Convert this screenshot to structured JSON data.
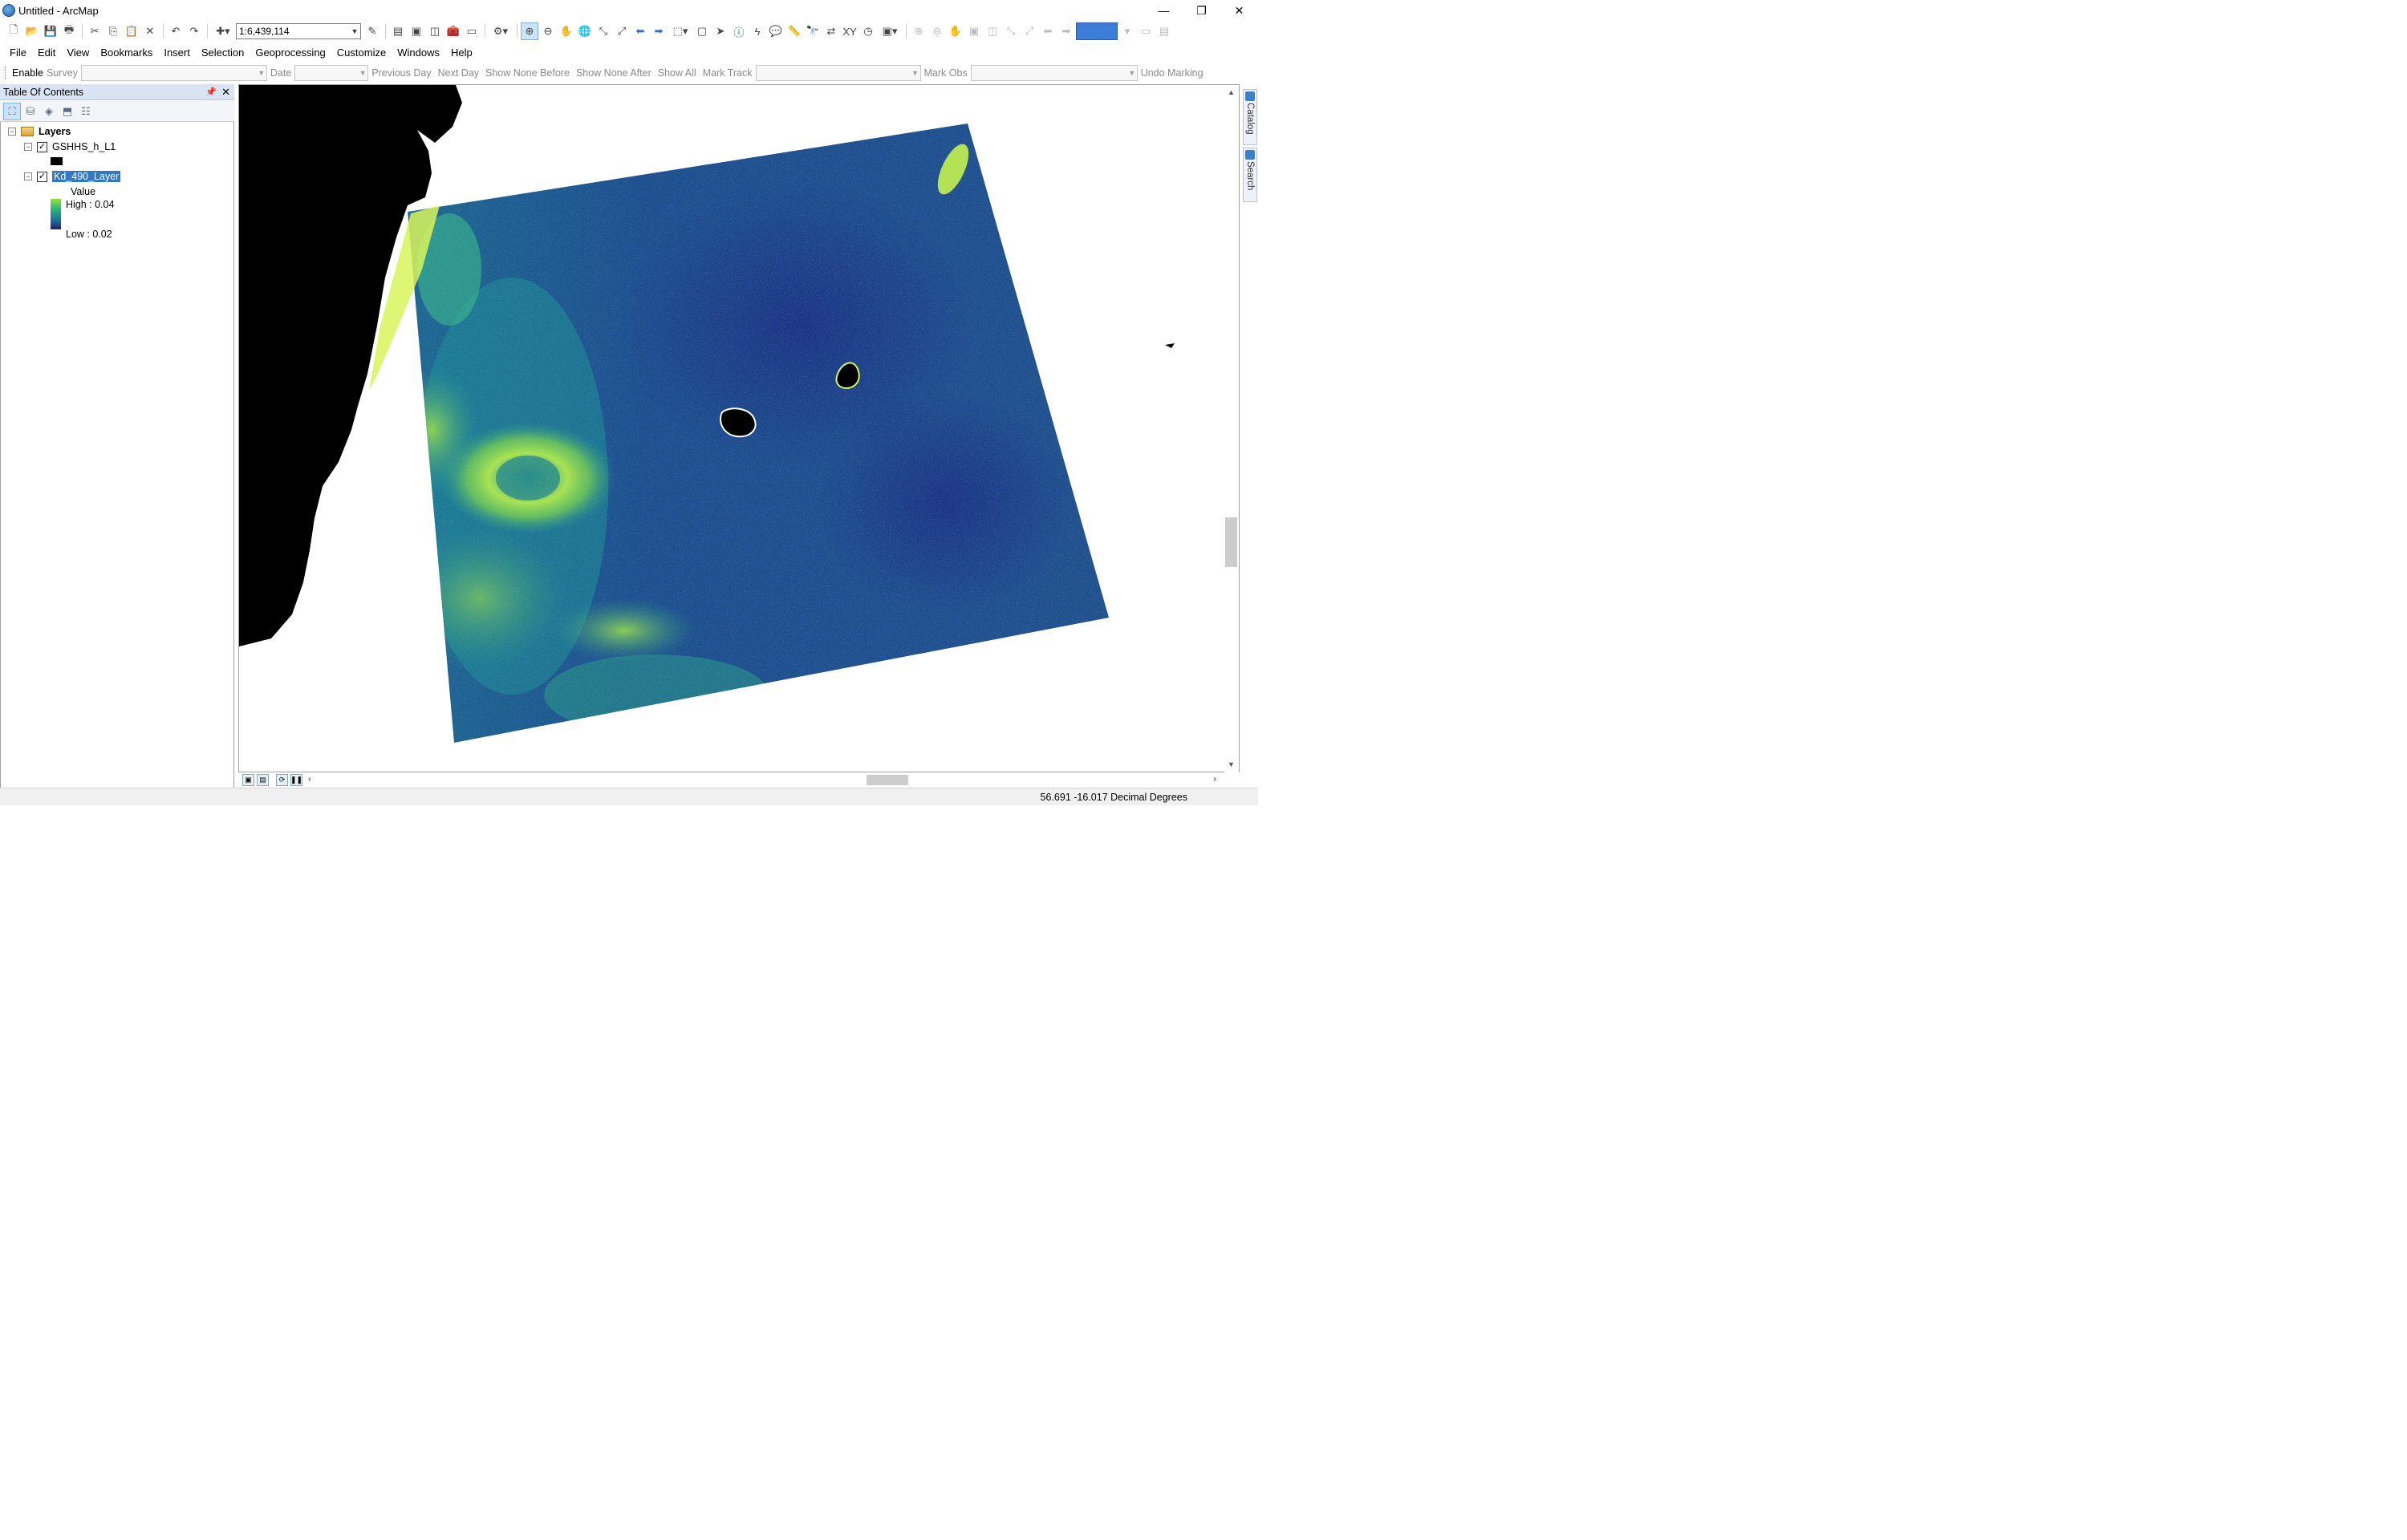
{
  "window": {
    "title": "Untitled - ArcMap",
    "controls": [
      "—",
      "❐",
      "✕"
    ]
  },
  "toolbar": {
    "scale": "1:6,439,114"
  },
  "menu": [
    "File",
    "Edit",
    "View",
    "Bookmarks",
    "Insert",
    "Selection",
    "Geoprocessing",
    "Customize",
    "Windows",
    "Help"
  ],
  "marking_toolbar": {
    "enable": "Enable",
    "survey": "Survey",
    "date": "Date",
    "previous_day": "Previous Day",
    "next_day": "Next Day",
    "show_none_before": "Show None Before",
    "show_none_after": "Show None After",
    "show_all": "Show All",
    "mark_track": "Mark Track",
    "mark_obs": "Mark Obs",
    "undo_marking": "Undo Marking"
  },
  "toc": {
    "title": "Table Of Contents",
    "root": "Layers",
    "layers": [
      {
        "name": "GSHHS_h_L1",
        "checked": true,
        "symbol_color": "#000000"
      },
      {
        "name": "Kd_490_Layer",
        "checked": true,
        "selected": true,
        "legend_title": "Value",
        "high": "High : 0.04",
        "low": "Low : 0.02"
      }
    ]
  },
  "side_tabs": [
    "Catalog",
    "Search"
  ],
  "status": {
    "coordinates": "56.691  -16.017 Decimal Degrees"
  },
  "colors": {
    "land": "#000000",
    "ramp_high": "#c8ff50",
    "ramp_mid": "#22a6a0",
    "ramp_low": "#1c2a7a",
    "selection": "#3178c6"
  }
}
